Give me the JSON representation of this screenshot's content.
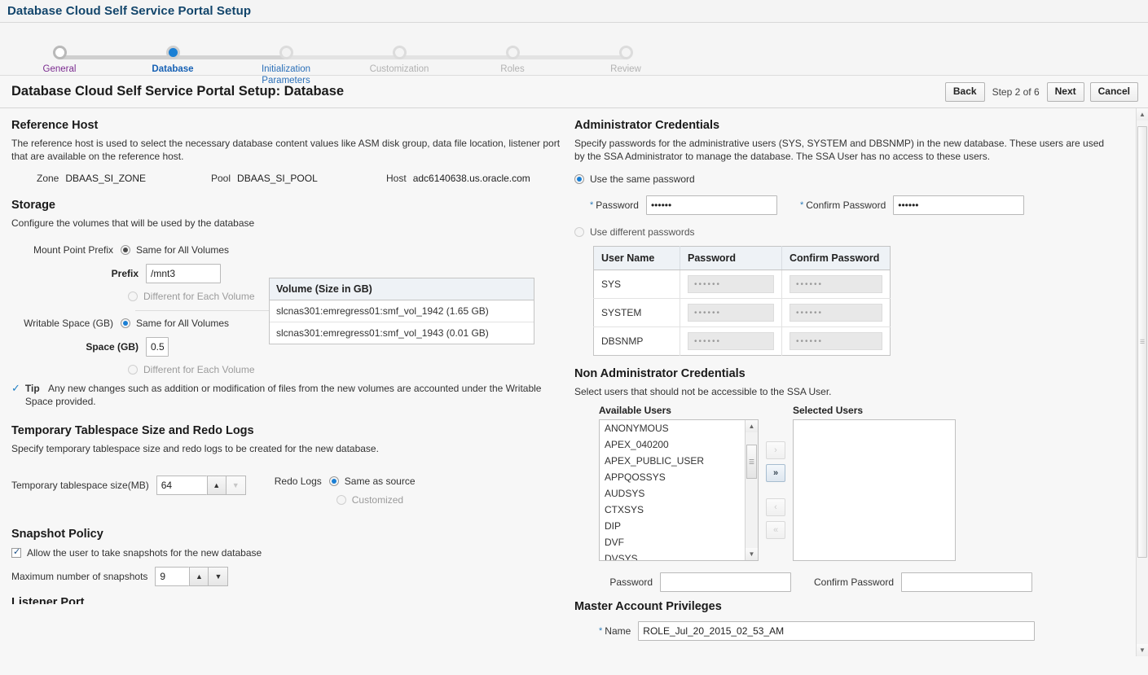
{
  "app": {
    "title": "Database Cloud Self Service Portal Setup"
  },
  "train": {
    "steps": [
      {
        "label": "General",
        "state": "visited"
      },
      {
        "label": "Database",
        "state": "current"
      },
      {
        "label": "Initialization Parameters",
        "state": "active-link"
      },
      {
        "label": "Customization",
        "state": "future"
      },
      {
        "label": "Roles",
        "state": "future"
      },
      {
        "label": "Review",
        "state": "future"
      }
    ]
  },
  "page": {
    "title": "Database Cloud Self Service Portal Setup: Database",
    "back_label": "Back",
    "step_count": "Step 2 of 6",
    "next_label": "Next",
    "cancel_label": "Cancel"
  },
  "reference_host": {
    "heading": "Reference Host",
    "description": "The reference host is used to select the necessary database content values like ASM disk group, data file location, listener port that are available on the reference host.",
    "zone_label": "Zone",
    "zone_value": "DBAAS_SI_ZONE",
    "pool_label": "Pool",
    "pool_value": "DBAAS_SI_POOL",
    "host_label": "Host",
    "host_value": "adc6140638.us.oracle.com"
  },
  "storage": {
    "heading": "Storage",
    "description": "Configure the volumes that will be used by the database",
    "mount_point_prefix_label": "Mount Point Prefix",
    "same_all_volumes_label": "Same for All Volumes",
    "different_each_volume_label": "Different for Each Volume",
    "prefix_label": "Prefix",
    "prefix_value": "/mnt3",
    "writable_space_label": "Writable Space (GB)",
    "space_label": "Space (GB)",
    "space_value": "0.5",
    "volume_header": "Volume (Size in GB)",
    "volumes": [
      "slcnas301:emregress01:smf_vol_1942 (1.65 GB)",
      "slcnas301:emregress01:smf_vol_1943 (0.01 GB)"
    ],
    "tip_label": "Tip",
    "tip_text": "Any new changes such as addition or modification of files from the new volumes are accounted under the Writable Space provided."
  },
  "temp_tablespace": {
    "heading": "Temporary Tablespace Size and Redo Logs",
    "description": "Specify temporary tablespace size and redo logs to be created for the new database.",
    "size_label": "Temporary tablespace size(MB)",
    "size_value": "64",
    "redo_logs_label": "Redo Logs",
    "same_as_source_label": "Same as source",
    "customized_label": "Customized"
  },
  "snapshot_policy": {
    "heading": "Snapshot Policy",
    "allow_label": "Allow the user to take snapshots for the new database",
    "max_label": "Maximum number of snapshots",
    "max_value": "9",
    "next_heading": "Listener Port"
  },
  "admin_credentials": {
    "heading": "Administrator Credentials",
    "description": "Specify passwords for the administrative users (SYS, SYSTEM and DBSNMP) in the new database. These users are used by the SSA Administrator to manage the database. The SSA User has no access to these users.",
    "use_same_label": "Use the same password",
    "use_different_label": "Use different passwords",
    "password_label": "Password",
    "password_value": "••••••",
    "confirm_label": "Confirm Password",
    "confirm_value": "••••••",
    "table": {
      "columns": [
        "User Name",
        "Password",
        "Confirm Password"
      ],
      "rows": [
        {
          "user": "SYS",
          "password": "••••••",
          "confirm": "••••••"
        },
        {
          "user": "SYSTEM",
          "password": "••••••",
          "confirm": "••••••"
        },
        {
          "user": "DBSNMP",
          "password": "••••••",
          "confirm": "••••••"
        }
      ]
    }
  },
  "non_admin_credentials": {
    "heading": "Non Administrator Credentials",
    "description": "Select users that should not be accessible to the SSA User.",
    "available_label": "Available Users",
    "selected_label": "Selected Users",
    "available_users": [
      "ANONYMOUS",
      "APEX_040200",
      "APEX_PUBLIC_USER",
      "APPQOSSYS",
      "AUDSYS",
      "CTXSYS",
      "DIP",
      "DVF",
      "DVSYS"
    ],
    "selected_users": [],
    "move_right_icon": "›",
    "move_all_right_icon": "»",
    "move_left_icon": "‹",
    "move_all_left_icon": "«",
    "password_label": "Password",
    "password_value": "",
    "confirm_label": "Confirm Password",
    "confirm_value": ""
  },
  "master_account": {
    "heading": "Master Account Privileges",
    "name_label": "Name",
    "name_value": "ROLE_Jul_20_2015_02_53_AM"
  },
  "colors": {
    "app_title": "#12456b",
    "accent_blue": "#1a7fd4",
    "visited_link": "#7a2a8f",
    "link": "#2a6fb8"
  }
}
